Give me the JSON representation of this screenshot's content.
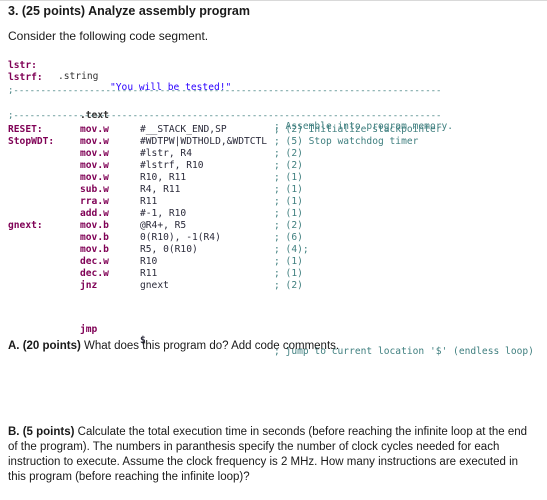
{
  "title": "3. (25 points) Analyze assembly program",
  "intro": "Consider the following code segment.",
  "data_section": [
    {
      "label": "lstr:",
      "directive": ".string",
      "value": "\"You will be tested!\""
    },
    {
      "label": "lstrf:",
      "directive": "",
      "value": ""
    }
  ],
  "separator": ";-------------------------------------------------------------------------------",
  "text_section": {
    "directive": ".text",
    "comment": "; Assemble into program memory."
  },
  "code_lines": [
    {
      "label": "RESET:",
      "mnemonic": "mov.w",
      "operands": "#__STACK_END,SP",
      "comment": "; (2) Initialize stackpointer"
    },
    {
      "label": "StopWDT:",
      "mnemonic": "mov.w",
      "operands": "#WDTPW|WDTHOLD,&WDTCTL",
      "comment": "; (5) Stop watchdog timer"
    },
    {
      "label": "",
      "mnemonic": "mov.w",
      "operands": "#lstr, R4",
      "comment": "; (2)"
    },
    {
      "label": "",
      "mnemonic": "mov.w",
      "operands": "#lstrf, R10",
      "comment": "; (2)"
    },
    {
      "label": "",
      "mnemonic": "mov.w",
      "operands": "R10, R11",
      "comment": "; (1)"
    },
    {
      "label": "",
      "mnemonic": "sub.w",
      "operands": "R4, R11",
      "comment": "; (1)"
    },
    {
      "label": "",
      "mnemonic": "rra.w",
      "operands": "R11",
      "comment": "; (1)"
    },
    {
      "label": "",
      "mnemonic": "add.w",
      "operands": "#-1, R10",
      "comment": "; (1)"
    },
    {
      "label": "gnext:",
      "mnemonic": "mov.b",
      "operands": "@R4+, R5",
      "comment": "; (2)"
    },
    {
      "label": "",
      "mnemonic": "mov.b",
      "operands": "0(R10), -1(R4)",
      "comment": "; (6)"
    },
    {
      "label": "",
      "mnemonic": "mov.b",
      "operands": "R5, 0(R10)",
      "comment": "; (4);"
    },
    {
      "label": "",
      "mnemonic": "dec.w",
      "operands": "R10",
      "comment": "; (1)"
    },
    {
      "label": "",
      "mnemonic": "dec.w",
      "operands": "R11",
      "comment": "; (1)"
    },
    {
      "label": "",
      "mnemonic": "jnz",
      "operands": "gnext",
      "comment": "; (2)"
    }
  ],
  "final_line": {
    "label": "",
    "mnemonic": "jmp",
    "operands": "$",
    "comment": "; jump to current location '$' (endless loop)"
  },
  "question_a": {
    "prefix": "A. (20 points)",
    "text": " What does this program do? Add code comments."
  },
  "question_b": {
    "prefix": "B. (5 points)",
    "text": " Calculate the total execution time in seconds (before reaching the infinite loop at the end of the program). The numbers in paranthesis specify the number of clock cycles needed for each instruction to execute. Assume the clock frequency is 2 MHz.  How many instructions are executed in this program (before reaching the infinite loop)?"
  },
  "colors": {
    "keyword": "#7f0055",
    "string": "#2a00ff",
    "comment": "#3f7f7f",
    "operand": "#2b2b3b"
  }
}
